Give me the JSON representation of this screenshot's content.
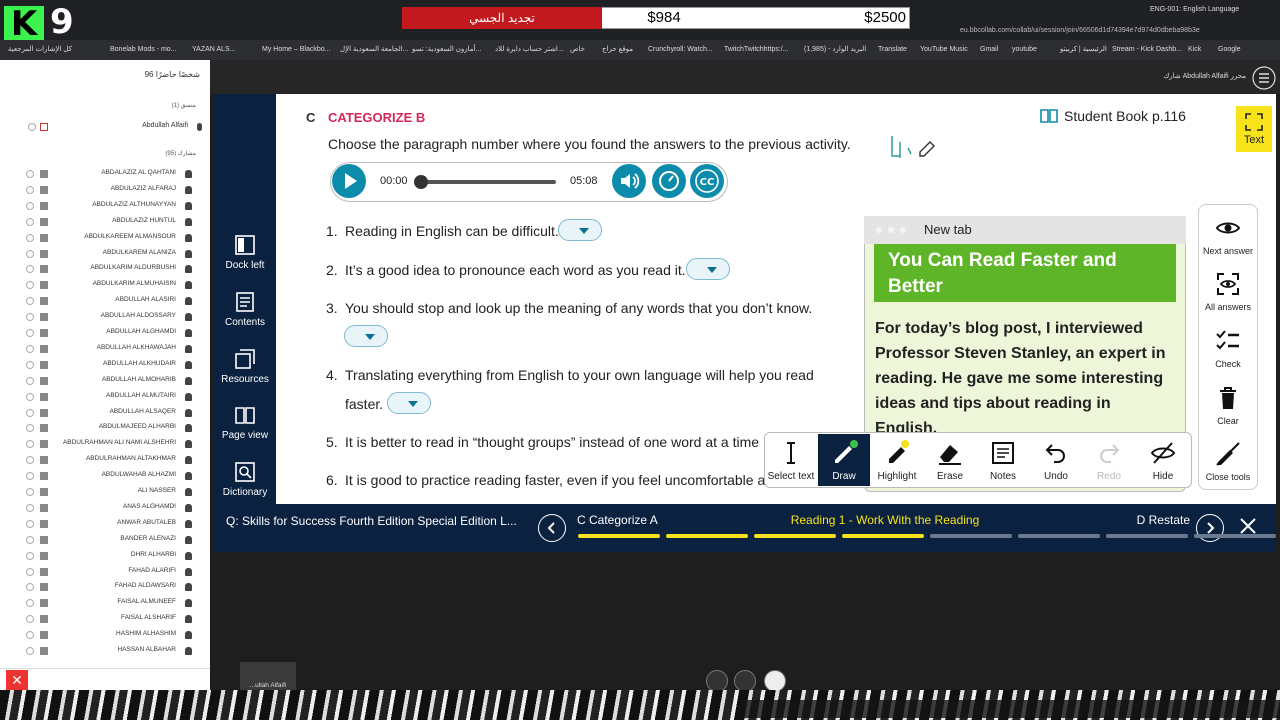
{
  "stream": {
    "logo_letter": "K",
    "logo_number": "9",
    "goal_label": "تجديد الجسي",
    "goal_current": "$984",
    "goal_target": "$2500",
    "goal_fraction": 0.39
  },
  "browser": {
    "tab_title": "ENG-001: English Language",
    "url": "eu.bbcollab.com/collab/ui/session/join/66506d1d74394e7d974d0dbeba98b3e",
    "bookmarks": [
      "كل الإشارات المرجعية",
      "Bonelab Mods - mo...",
      "YAZAN ALS...",
      "My Home – Blackbo...",
      "الجامعة السعودية الإل...",
      "أمازون السعودية: تسو...",
      "اشتر حساب دايرة للاد...",
      "خاص",
      "موقع حراج",
      "Crunchyroll: Watch...",
      "TwitchTwitchhttps:/...",
      "(1,985) - البريد الوارد",
      "Translate",
      "YouTube Music",
      "Gmail",
      "youtube",
      "الرئيسية | كريبتو",
      "Stream - Kick Dashb...",
      "Kick",
      "Google"
    ]
  },
  "collab": {
    "session_user": "شارك Abdullah Alfaifi محرر"
  },
  "participants": {
    "count_label": "96 شخصًا حاضرًا",
    "moderator_heading": "منسق (1)",
    "moderator_name": "Abdullah Alfaifi",
    "attendee_heading": "مشارك (95)",
    "names": [
      "ABDALAZIZ AL QAHTANI",
      "ABDULAZIZ ALFARAJ",
      "ABDULAZIZ ALTHUNAYYAN",
      "ABDULAZIZ HUNTUL",
      "ABDULKAREEM ALMANSOUR",
      "ABDULKAREM ALANIZA",
      "ABDULKARIM ALDURBUSHI",
      "ABDULKARIM ALMUHAISIN",
      "ABDULLAH ALASIRI",
      "ABDULLAH ALDOSSARY",
      "ABDULLAH ALGHAMDI",
      "ABDULLAH ALKHAWAJAH",
      "ABDULLAH ALKHUDAIR",
      "ABDULLAH ALMOHARIB",
      "ABDULLAH ALMUTAIRI",
      "ABDULLAH ALSAQER",
      "ABDULMAJEED ALHARBI",
      "ABDULRAHMAN ALI NAMI ALSHEHRI",
      "ABDULRAHMAN ALTAKHMAR",
      "ABDULWAHAB ALHAZMI",
      "ALI NASSER",
      "ANAS ALGHAMDI",
      "ANWAR ABUTALEB",
      "BANDER ALENAZI",
      "DHRI ALHARBI",
      "FAHAD ALARIFI",
      "FAHAD ALDAWSARI",
      "FAISAL ALMUNEEF",
      "FAISAL ALSHARIF",
      "HASHIM ALHASHIM",
      "HASSAN ALBAHAR"
    ],
    "self_label": "...ullah Alfaifi"
  },
  "side_nav": [
    "Dock left",
    "Contents",
    "Resources",
    "Page view",
    "Dictionary"
  ],
  "activity": {
    "section_letter": "C",
    "section_title": "CATEGORIZE B",
    "book_ref": "Student Book p.116",
    "instruction": "Choose the paragraph number where you found the answers to the previous activity.",
    "audio": {
      "current": "00:00",
      "total": "05:08",
      "progress": 0.0
    },
    "questions": [
      {
        "num": "1.",
        "text": "Reading in English can be difficult."
      },
      {
        "num": "2.",
        "text": "It’s a good idea to pronounce each word as you read it."
      },
      {
        "num": "3.",
        "text": "You should stop and look up the meaning of any words that you don’t know."
      },
      {
        "num": "4.",
        "text": "Translating everything from English to your own language will help you read",
        "text2": "faster."
      },
      {
        "num": "5.",
        "text": "It is better to read in “thought groups” instead of one word at a time"
      },
      {
        "num": "6.",
        "text": "It is good to practice reading faster, even if you feel uncomfortable a"
      }
    ]
  },
  "reading_popup": {
    "tab": "New tab",
    "heading": "You Can Read Faster and Better",
    "body": "For today’s blog post, I interviewed Professor Steven Stanley, an expert in reading. He gave me some interesting ideas and tips about reading in English."
  },
  "right_tools": [
    "Next answer",
    "All answers",
    "Check",
    "Clear",
    "Close tools"
  ],
  "text_tool": "Text",
  "draw_tools": [
    "Select text",
    "Draw",
    "Highlight",
    "Erase",
    "Notes",
    "Undo",
    "Redo",
    "Hide"
  ],
  "bottom_nav": {
    "course": "Q: Skills for Success Fourth Edition Special Edition L...",
    "prev": "C Categorize A",
    "current": "Reading 1 - Work With the Reading",
    "next": "D Restate",
    "segments_done": 4,
    "segments_total": 8
  },
  "colors": {
    "accent": "#d4285a",
    "teal": "#0d8bab",
    "navy": "#0a2140",
    "yellow": "#f7e31b",
    "green": "#5eb527"
  }
}
